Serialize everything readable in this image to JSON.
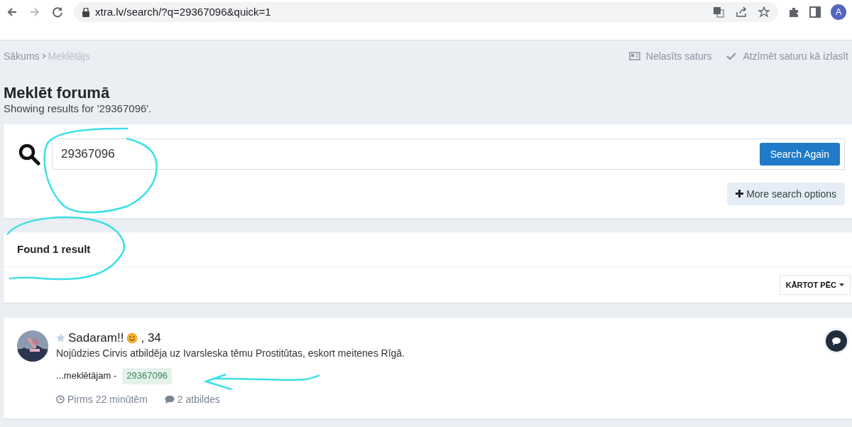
{
  "browser": {
    "url": "xtra.lv/search/?q=29367096&quick=1",
    "profile_initial": "A"
  },
  "breadcrumb": [
    "Sākums",
    "Meklētājs"
  ],
  "header_links": [
    {
      "kind": "unread",
      "label": "Nelasīts saturs"
    },
    {
      "kind": "mark_read",
      "label": "Atzīmēt saturu kā izlasīt"
    }
  ],
  "page_title": "Meklēt forumā",
  "subtitle": "Showing results for '29367096'.",
  "search": {
    "value": "29367096",
    "button": "Search Again",
    "more_options": "More search options"
  },
  "results_header": {
    "title": "Found 1 result",
    "sort": "KĀRTOT PĒC"
  },
  "results": [
    {
      "title": "Sadaram!!",
      "title_suffix": ", 34",
      "summary": "Nojūdzies Cirvis atbildēja uz Ivarsleska tēmu Prostitūtas, eskort meitenes Rīgā.",
      "snippet": "...meklētājam -",
      "highlight": "29367096",
      "time": "Pirms 22 minūtēm",
      "replies": "2 atbildes"
    }
  ],
  "annotations": [
    {
      "kind": "loop"
    },
    {
      "kind": "loop"
    },
    {
      "kind": "arrow"
    }
  ]
}
